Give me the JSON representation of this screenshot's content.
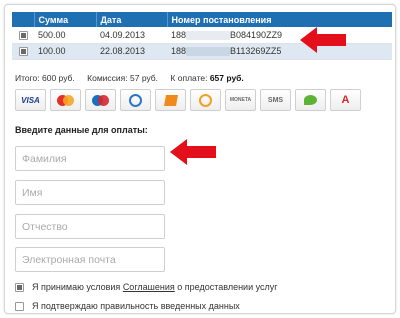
{
  "table": {
    "headers": [
      "",
      "Сумма",
      "Дата",
      "Номер постановления"
    ],
    "rows": [
      {
        "checked": true,
        "amount": "500.00",
        "date": "04.09.2013",
        "num_prefix": "188",
        "num_suffix": "B084190ZZ9"
      },
      {
        "checked": true,
        "amount": "100.00",
        "date": "22.08.2013",
        "num_prefix": "188",
        "num_suffix": "B113269ZZ5"
      }
    ]
  },
  "totals": {
    "total_label": "Итого:",
    "total_value": "600 руб.",
    "commission_label": "Комиссия:",
    "commission_value": "57 руб.",
    "topay_label": "К оплате:",
    "topay_value": "657 руб."
  },
  "payment_methods": [
    {
      "name": "visa",
      "label": "VISA"
    },
    {
      "name": "mastercard",
      "label": "MasterCard"
    },
    {
      "name": "maestro",
      "label": "Maestro"
    },
    {
      "name": "webmoney",
      "label": "WebMoney"
    },
    {
      "name": "yandex-money",
      "label": "Яндекс.Деньги"
    },
    {
      "name": "qiwi",
      "label": "QIWI"
    },
    {
      "name": "moneta",
      "label": "MONETA.RU"
    },
    {
      "name": "sms",
      "label": "SMS"
    },
    {
      "name": "sberbank",
      "label": "Сбербанк"
    },
    {
      "name": "alfa",
      "label": "А"
    }
  ],
  "form": {
    "title": "Введите данные для оплаты:",
    "surname_placeholder": "Фамилия",
    "name_placeholder": "Имя",
    "patronymic_placeholder": "Отчество",
    "email_placeholder": "Электронная почта"
  },
  "agreements": {
    "terms_prefix": "Я принимаю условия",
    "terms_link": "Соглашения",
    "terms_suffix": "о предоставлении услуг",
    "terms_checked": true,
    "confirm_text": "Я подтверждаю правильность введенных данных",
    "confirm_checked": false
  },
  "colors": {
    "header_bg": "#1f6fb3",
    "row_alt": "#dde8f2",
    "arrow": "#e3101b"
  }
}
